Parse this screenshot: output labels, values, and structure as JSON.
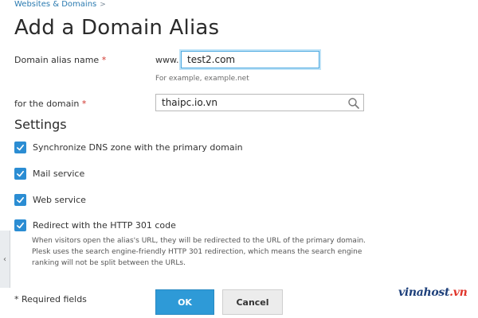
{
  "breadcrumb": {
    "item": "Websites & Domains",
    "separator": ">"
  },
  "page_title": "Add a Domain Alias",
  "form": {
    "alias_name": {
      "label": "Domain alias name",
      "required_mark": "*",
      "prefix": "www.",
      "value": "test2.com",
      "hint": "For example, example.net"
    },
    "for_domain": {
      "label": "for the domain",
      "required_mark": "*",
      "value": "thaipc.io.vn",
      "icon": "search-icon"
    }
  },
  "settings": {
    "title": "Settings",
    "options": [
      {
        "label": "Synchronize DNS zone with the primary domain",
        "checked": true
      },
      {
        "label": "Mail service",
        "checked": true
      },
      {
        "label": "Web service",
        "checked": true
      },
      {
        "label": "Redirect with the HTTP 301 code",
        "checked": true
      }
    ],
    "redirect_description": "When visitors open the alias's URL, they will be redirected to the URL of the primary domain. Plesk uses the search engine-friendly HTTP 301 redirection, which means the search engine ranking will not be split between the URLs."
  },
  "footer": {
    "required_note": "* Required fields",
    "ok_label": "OK",
    "cancel_label": "Cancel"
  },
  "side_tab": {
    "glyph": "‹"
  },
  "watermark": {
    "text": "vinahost",
    "suffix": ".vn"
  },
  "colors": {
    "accent": "#2e9ad7",
    "checkbox": "#2b8dd3",
    "required": "#d0342c",
    "link": "#2a7ab0"
  }
}
